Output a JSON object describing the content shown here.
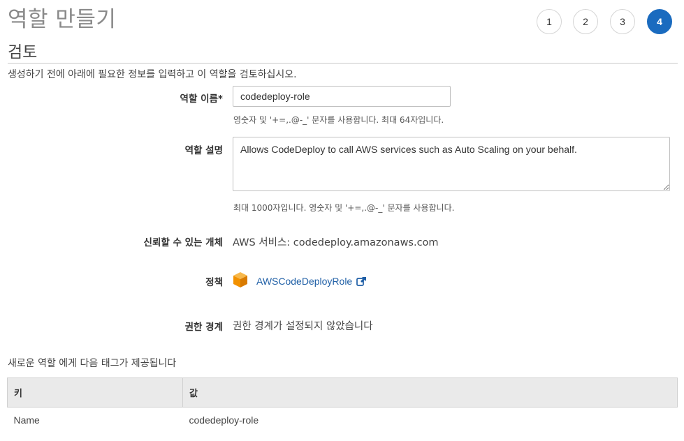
{
  "wizard": {
    "title": "역할 만들기",
    "steps": [
      {
        "label": "1",
        "active": false
      },
      {
        "label": "2",
        "active": false
      },
      {
        "label": "3",
        "active": false
      },
      {
        "label": "4",
        "active": true
      }
    ]
  },
  "review": {
    "section_title": "검토",
    "intro": "생성하기 전에 아래에 필요한 정보를 입력하고 이 역할을 검토하십시오.",
    "role_name": {
      "label": "역할 이름*",
      "value": "codedeploy-role",
      "help": "영숫자 및 '+=,.@-_' 문자를 사용합니다. 최대 64자입니다."
    },
    "role_description": {
      "label": "역할 설명",
      "value": "Allows CodeDeploy to call AWS services such as Auto Scaling on your behalf.",
      "help": "최대 1000자입니다. 영숫자 및 '+=,.@-_' 문자를 사용합니다."
    },
    "trusted_entity": {
      "label": "신뢰할 수 있는 개체",
      "value": "AWS 서비스: codedeploy.amazonaws.com"
    },
    "policy": {
      "label": "정책",
      "icon": "aws-package-icon",
      "link_text": "AWSCodeDeployRole",
      "link_icon": "external-link-icon"
    },
    "permissions_boundary": {
      "label": "권한 경계",
      "value": "권한 경계가 설정되지 않았습니다"
    }
  },
  "tags": {
    "heading": "새로운 역할 에게 다음 태그가 제공됩니다",
    "columns": {
      "key": "키",
      "value": "값"
    },
    "rows": [
      {
        "key": "Name",
        "value": "codedeploy-role"
      }
    ]
  },
  "colors": {
    "accent": "#1a6bbf",
    "link": "#1f5fa6",
    "aws_orange": "#f5a623"
  }
}
